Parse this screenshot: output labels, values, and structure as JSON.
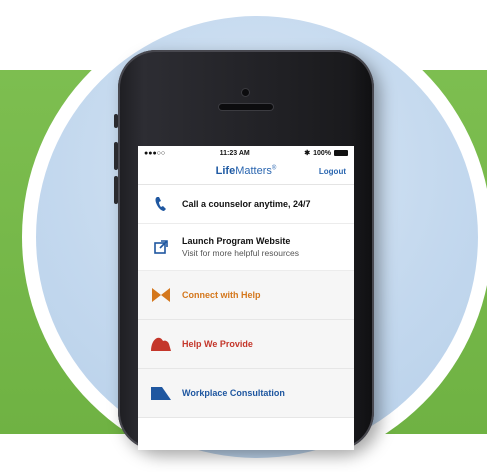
{
  "status_bar": {
    "signal": "●●●○○",
    "time": "11:23 AM",
    "battery": "100%"
  },
  "header": {
    "brand_bold": "Life",
    "brand_regular": "Matters",
    "brand_mark": "®",
    "logout_label": "Logout"
  },
  "menu": {
    "call": {
      "label": "Call a counselor anytime, 24/7",
      "icon": "phone-icon"
    },
    "website": {
      "label": "Launch Program Website",
      "sublabel": "Visit for more helpful resources",
      "icon": "external-link-icon"
    },
    "connect": {
      "label": "Connect with Help",
      "icon": "bowtie-icon",
      "color": "#d4771c"
    },
    "help": {
      "label": "Help We Provide",
      "icon": "shape-icon",
      "color": "#c4362a"
    },
    "workplace": {
      "label": "Workplace Consultation",
      "icon": "trapezoid-icon",
      "color": "#1f57a0"
    }
  },
  "colors": {
    "background_green": "#7dbe50",
    "sky_blue": "#c3d8ee",
    "brand_blue": "#2a66b0"
  }
}
